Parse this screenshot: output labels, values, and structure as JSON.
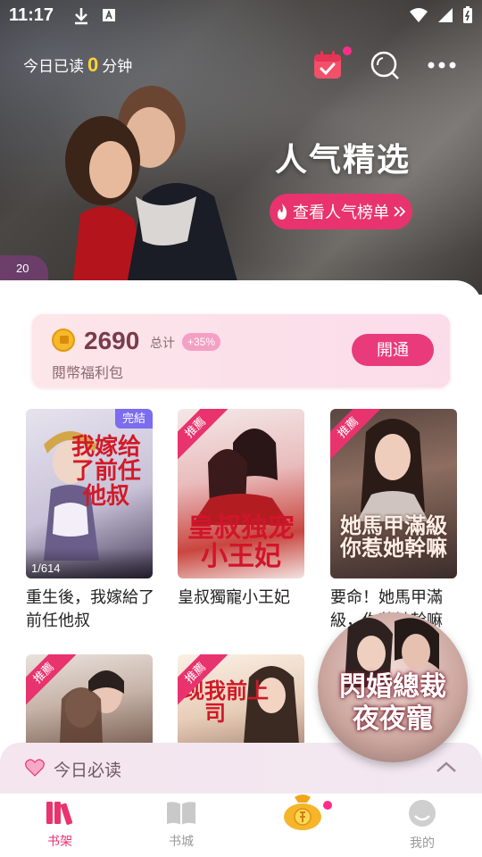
{
  "status": {
    "time": "11:17"
  },
  "hero": {
    "read_prefix": "今日已读",
    "read_minutes": "0",
    "read_suffix": "分钟",
    "title": "人气精选",
    "rank_button": "查看人气榜单",
    "page_indicator": "20"
  },
  "coins": {
    "amount": "2690",
    "total_label": "总计",
    "bonus": "+35%",
    "sub_label": "閱幣福利包",
    "open_button": "開通"
  },
  "books": [
    {
      "title": "重生後，我嫁給了前任他叔",
      "badge": "完結",
      "chapters": "1/614",
      "cover_text": "我嫁给了前任他叔"
    },
    {
      "title": "皇叔獨寵小王妃",
      "badge": "推薦",
      "cover_text": "皇叔独宠小王妃"
    },
    {
      "title": "要命！她馬甲滿級，你惹她幹嘛",
      "badge": "推薦",
      "cover_text": "她馬甲滿級你惹她幹嘛"
    },
    {
      "title": "",
      "badge": "推薦"
    },
    {
      "title": "",
      "badge": "推薦",
      "cover_text": "发现我前上司"
    }
  ],
  "promo": {
    "line1": "閃婚總裁",
    "line2": "夜夜寵"
  },
  "daily": {
    "label": "今日必读"
  },
  "nav": [
    {
      "label": "书架"
    },
    {
      "label": "书城"
    },
    {
      "label": ""
    },
    {
      "label": "我的"
    }
  ],
  "colors": {
    "accent": "#e8336e",
    "gold": "#ffd23a",
    "purple_badge": "#7b6cf0"
  }
}
